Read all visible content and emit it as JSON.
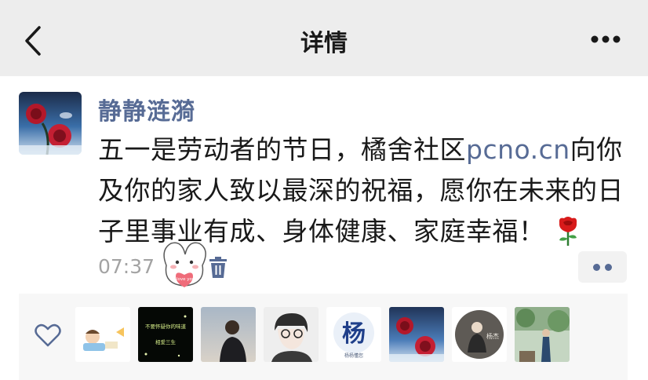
{
  "header": {
    "title": "详情"
  },
  "post": {
    "username": "静静涟漪",
    "text_before": "五一是劳动者的节日，橘舍社区",
    "link": "pcno.cn",
    "text_after": "向你及你的家人致以最深的祝福，愿你在未来的日子里事业有成、身体健康、家庭幸福！",
    "time": "07:37",
    "sticker_text": "I love you"
  },
  "likes": {
    "liker_avatars": [
      {
        "name": "cartoon-child-avatar"
      },
      {
        "name": "dark-calligraphy-avatar",
        "text": "不要怀疑你的味道 相爱三生"
      },
      {
        "name": "boy-photo-avatar"
      },
      {
        "name": "anime-boy-avatar"
      },
      {
        "name": "calligraphy-yang-avatar",
        "text": "杨",
        "caption": "杨杨懂您"
      },
      {
        "name": "rose-avatar"
      },
      {
        "name": "round-portrait-avatar",
        "text": "杨杰"
      },
      {
        "name": "outdoor-photo-avatar"
      }
    ]
  },
  "colors": {
    "header_bg": "#ededed",
    "link": "#576b95",
    "muted": "#a3a3a3",
    "likes_bg": "#f7f7f7"
  }
}
